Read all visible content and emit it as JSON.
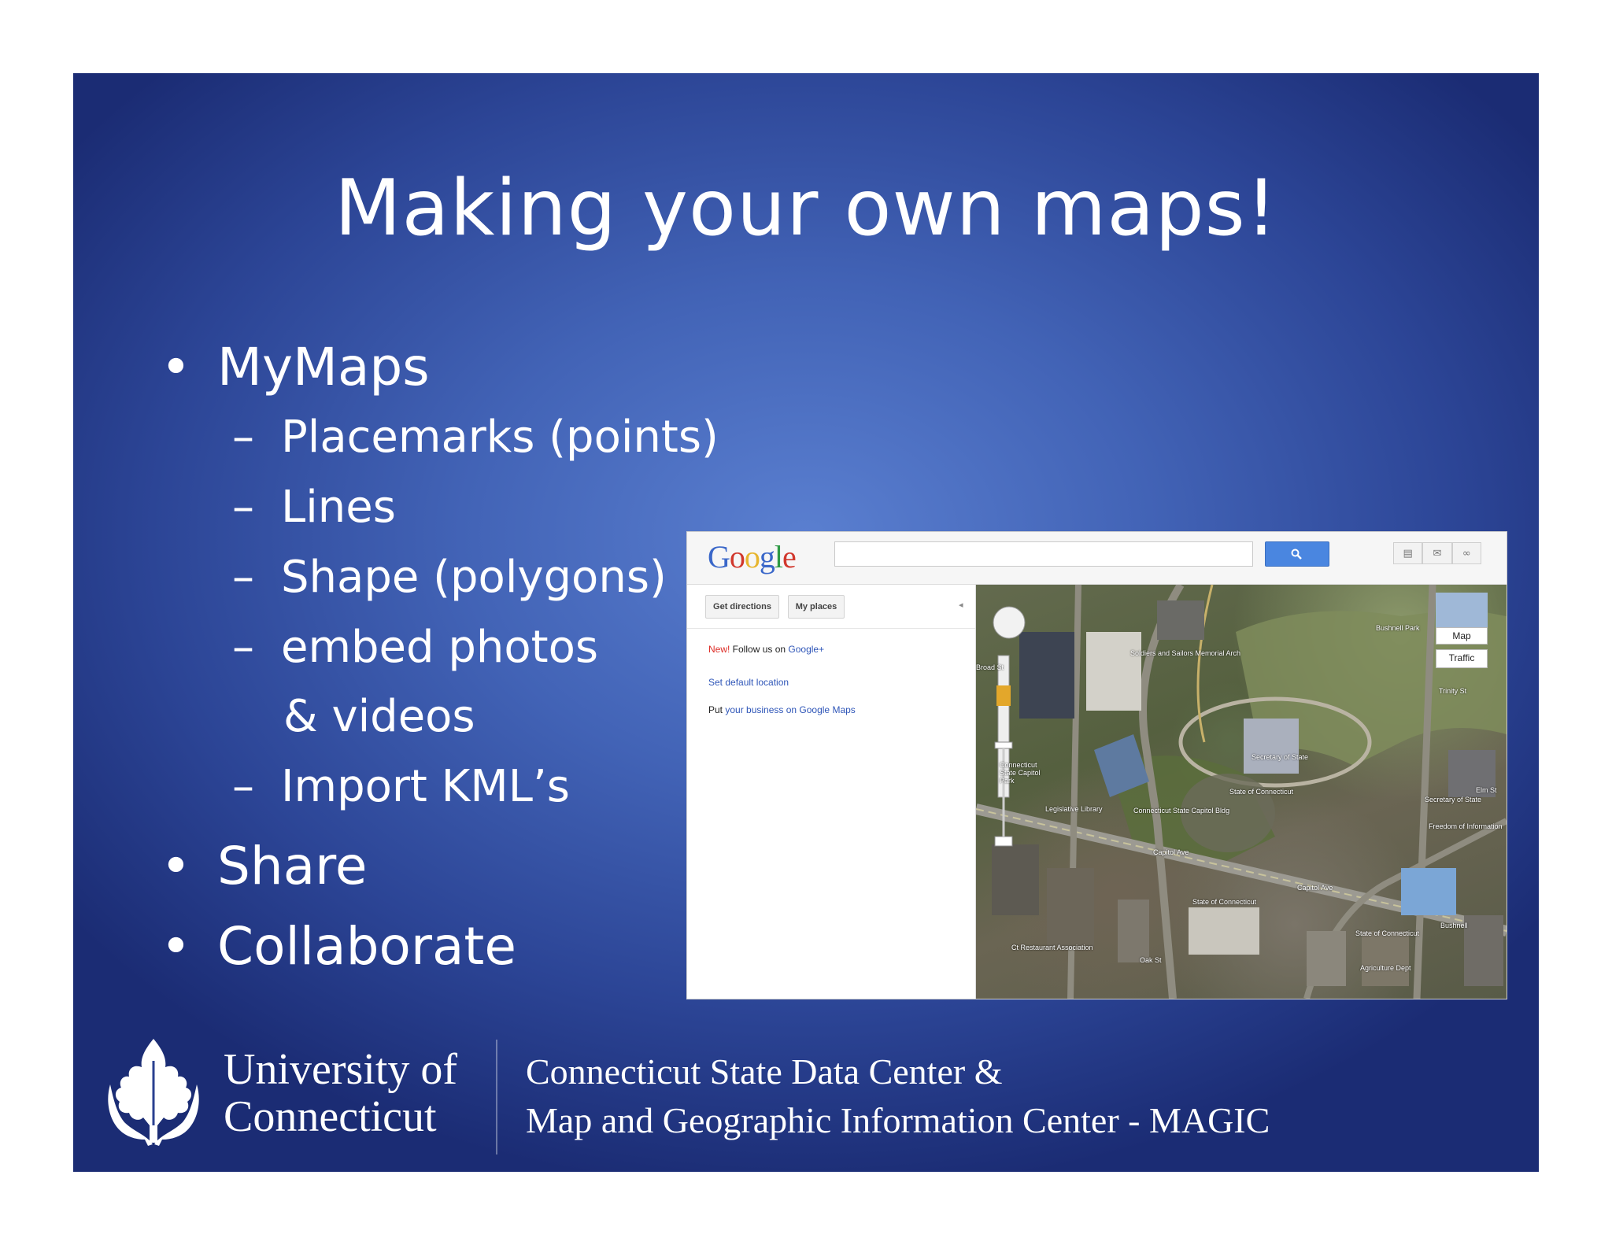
{
  "slide": {
    "title": "Making your own maps!"
  },
  "bullets": {
    "mymaps": "MyMaps",
    "placemarks": "Placemarks (points)",
    "lines": "Lines",
    "shape": "Shape (polygons)",
    "embed_line1": "embed photos",
    "embed_line2": "& videos",
    "import": "Import KML’s",
    "share": "Share",
    "collaborate": "Collaborate",
    "bullet_glyph": "•",
    "dash_glyph": "–"
  },
  "screenshot": {
    "logo_text": [
      "G",
      "o",
      "o",
      "g",
      "l",
      "e"
    ],
    "search_value": "",
    "search_icon": "magnifier-icon",
    "tool_icons": [
      "print-icon",
      "mail-icon",
      "link-icon"
    ],
    "get_directions": "Get directions",
    "my_places": "My places",
    "collapse_glyph": "◂",
    "new_label": "New!",
    "follow_text": " Follow us on ",
    "google_plus": "Google+",
    "set_default": "Set default location",
    "put_text": "Put ",
    "business_link": "your business on Google Maps",
    "map_button": "Map",
    "traffic_button": "Traffic",
    "map_labels": [
      "Bushnell Park",
      "Soldiers and Sailors Memorial Arch",
      "Secretary of State",
      "Connecticut State Capitol Park",
      "State of Connecticut",
      "Legislative Library",
      "Connecticut State Capitol Bldg",
      "Capitol Ave",
      "Elm St",
      "Secretary of State",
      "Freedom of Information",
      "State of Connecticut",
      "Capitol Ave",
      "State of Connecticut",
      "Bushnell",
      "Ct Restaurant Association",
      "Agriculture Dept",
      "Trinity St",
      "Oak St",
      "Broad St"
    ]
  },
  "footer": {
    "university_line1": "University of",
    "university_line2": "Connecticut",
    "center_line1": "Connecticut State Data Center &",
    "center_line2": "Map and Geographic Information Center - MAGIC"
  },
  "colors": {
    "slide_bg": "#3b5aad",
    "text": "#ffffff",
    "google_blue": "#4a86e0"
  }
}
